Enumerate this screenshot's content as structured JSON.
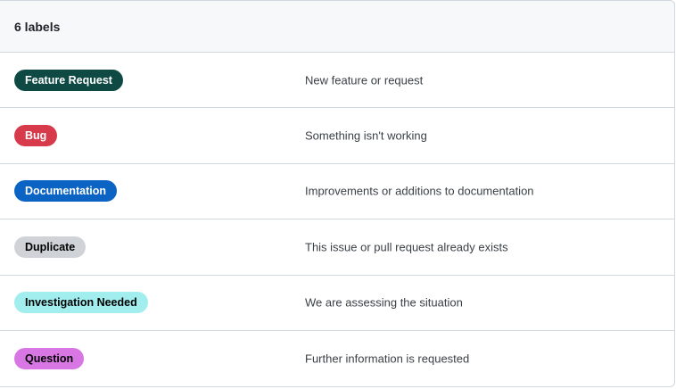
{
  "header": {
    "title": "6 labels"
  },
  "labels": [
    {
      "name": "Feature Request",
      "description": "New feature or request",
      "bg": "#0e4a43",
      "fg": "#ffffff"
    },
    {
      "name": "Bug",
      "description": "Something isn't working",
      "bg": "#d73a4a",
      "fg": "#ffffff"
    },
    {
      "name": "Documentation",
      "description": "Improvements or additions to documentation",
      "bg": "#0b63c4",
      "fg": "#ffffff"
    },
    {
      "name": "Duplicate",
      "description": "This issue or pull request already exists",
      "bg": "#cfd3d7",
      "fg": "#000000"
    },
    {
      "name": "Investigation Needed",
      "description": "We are assessing the situation",
      "bg": "#a2eeef",
      "fg": "#000000"
    },
    {
      "name": "Question",
      "description": "Further information is requested",
      "bg": "#d876e3",
      "fg": "#000000"
    }
  ]
}
